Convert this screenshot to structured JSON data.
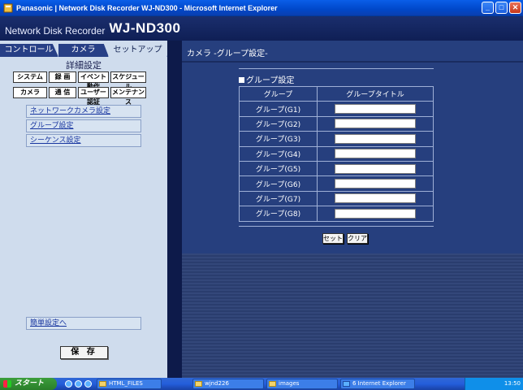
{
  "window": {
    "title": "Panasonic | Network Disk Recorder WJ-ND300 - Microsoft Internet Explorer"
  },
  "header": {
    "subtitle": "Network Disk Recorder",
    "model": "WJ-ND300"
  },
  "sidebar": {
    "tabs": [
      {
        "label": "コントロール"
      },
      {
        "label": "カメラ"
      },
      {
        "label": "セットアップ"
      }
    ],
    "section_title": "詳細設定",
    "nav_row1": [
      {
        "label": "システム"
      },
      {
        "label": "録 画"
      },
      {
        "label": "イベント動作"
      },
      {
        "label": "スケジュール"
      }
    ],
    "nav_row2": [
      {
        "label": "カメラ"
      },
      {
        "label": "通 信"
      },
      {
        "label": "ユーザー認証"
      },
      {
        "label": "メンテナンス"
      }
    ],
    "links": [
      {
        "label": "ネットワークカメラ設定"
      },
      {
        "label": "グループ設定"
      },
      {
        "label": "シーケンス設定"
      }
    ],
    "simple_link": "簡単設定へ",
    "save_label": "保 存"
  },
  "main": {
    "page_title": "カメラ -グループ設定-",
    "section_title": "グループ設定",
    "columns": [
      "グループ",
      "グループタイトル"
    ],
    "rows": [
      {
        "group": "グループ(G1)",
        "title": ""
      },
      {
        "group": "グループ(G2)",
        "title": ""
      },
      {
        "group": "グループ(G3)",
        "title": ""
      },
      {
        "group": "グループ(G4)",
        "title": ""
      },
      {
        "group": "グループ(G5)",
        "title": ""
      },
      {
        "group": "グループ(G6)",
        "title": ""
      },
      {
        "group": "グループ(G7)",
        "title": ""
      },
      {
        "group": "グループ(G8)",
        "title": ""
      }
    ],
    "set_label": "セット",
    "clear_label": "クリア"
  },
  "taskbar": {
    "start_label": "スタート",
    "items": [
      {
        "label": "HTML_FILES"
      },
      {
        "label": "wjnd226"
      },
      {
        "label": "images"
      },
      {
        "label": "6 Internet Explorer"
      }
    ],
    "clock": "13:50"
  }
}
